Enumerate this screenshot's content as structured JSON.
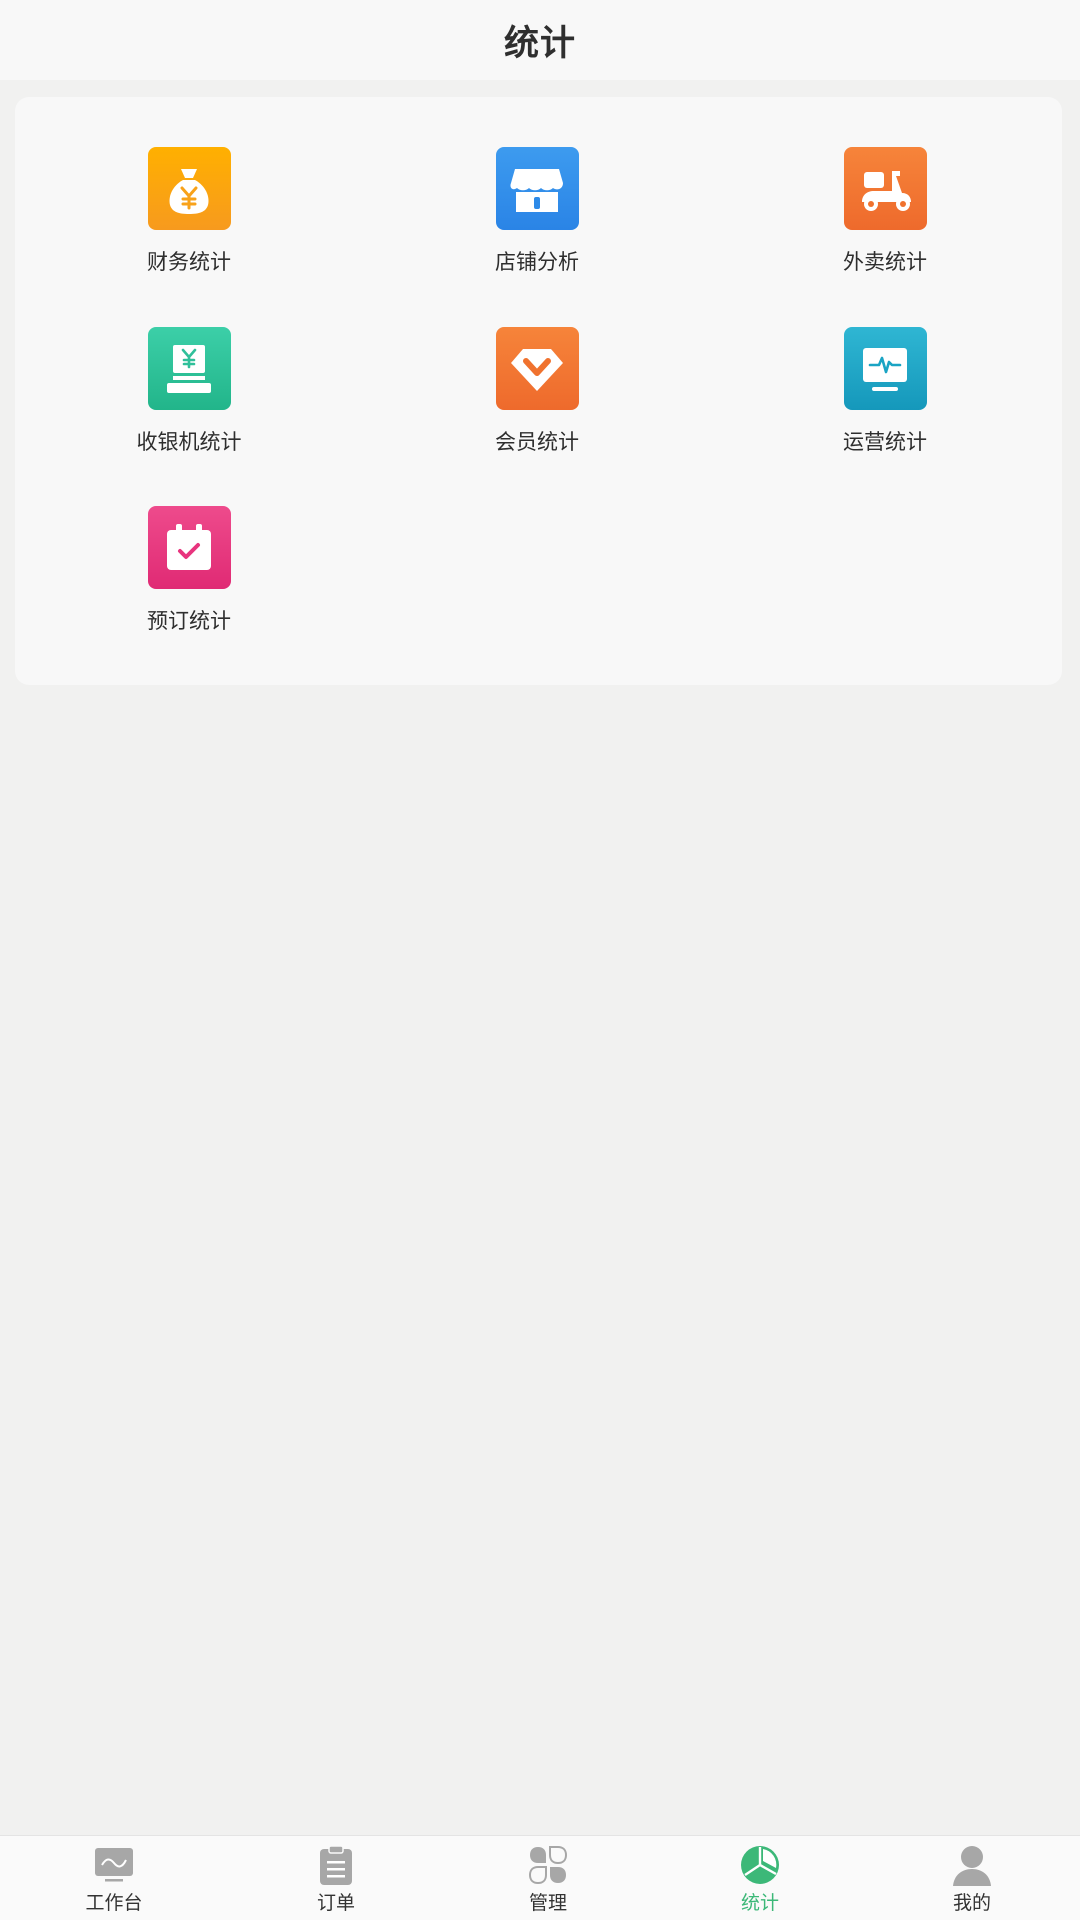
{
  "header": {
    "title": "统计"
  },
  "menu": {
    "items": [
      {
        "label": "财务统计",
        "icon": "money-bag-icon",
        "color": "#f8a21a"
      },
      {
        "label": "店铺分析",
        "icon": "store-icon",
        "color": "#2d8ae8"
      },
      {
        "label": "外卖统计",
        "icon": "scooter-icon",
        "color": "#f0722e"
      },
      {
        "label": "收银机统计",
        "icon": "cash-register-icon",
        "color": "#30c09a"
      },
      {
        "label": "会员统计",
        "icon": "diamond-icon",
        "color": "#f0722e"
      },
      {
        "label": "运营统计",
        "icon": "monitor-pulse-icon",
        "color": "#1aa4c4"
      },
      {
        "label": "预订统计",
        "icon": "calendar-check-icon",
        "color": "#e8347e"
      }
    ]
  },
  "tabbar": {
    "active_color": "#3cb878",
    "inactive_color": "#a7a7a7",
    "tabs": [
      {
        "label": "工作台",
        "icon": "monitor-icon",
        "active": false
      },
      {
        "label": "订单",
        "icon": "clipboard-icon",
        "active": false
      },
      {
        "label": "管理",
        "icon": "grid-leaf-icon",
        "active": false
      },
      {
        "label": "统计",
        "icon": "pie-chart-icon",
        "active": true
      },
      {
        "label": "我的",
        "icon": "user-icon",
        "active": false
      }
    ]
  }
}
